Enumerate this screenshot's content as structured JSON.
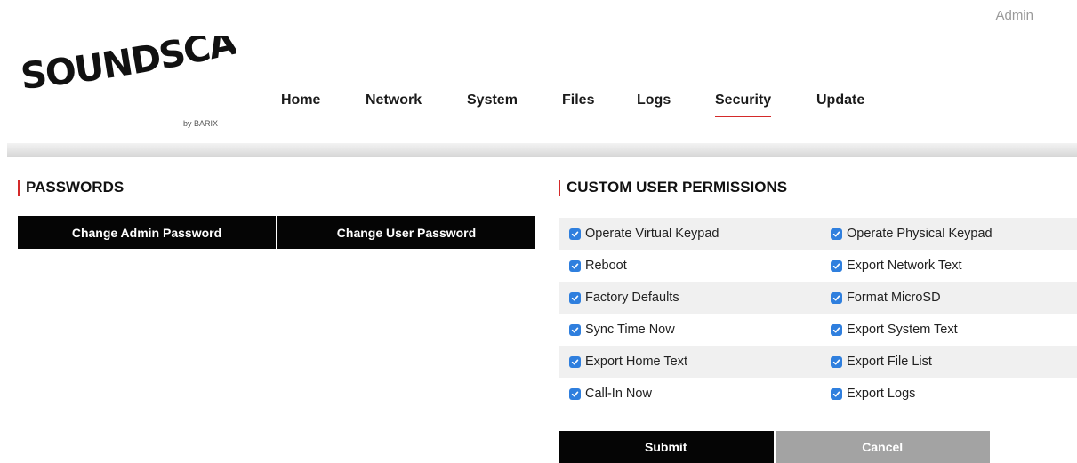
{
  "header": {
    "user_label": "Admin",
    "logo_text": "SOUNDSCAPE",
    "logo_sub": "by BARIX"
  },
  "nav": {
    "items": [
      {
        "label": "Home",
        "active": false
      },
      {
        "label": "Network",
        "active": false
      },
      {
        "label": "System",
        "active": false
      },
      {
        "label": "Files",
        "active": false
      },
      {
        "label": "Logs",
        "active": false
      },
      {
        "label": "Security",
        "active": true
      },
      {
        "label": "Update",
        "active": false
      }
    ],
    "active_color": "#d42a2a"
  },
  "passwords": {
    "title": "PASSWORDS",
    "change_admin_label": "Change Admin Password",
    "change_user_label": "Change User Password"
  },
  "permissions": {
    "title": "CUSTOM USER PERMISSIONS",
    "rows": [
      [
        {
          "label": "Operate Virtual Keypad",
          "checked": true
        },
        {
          "label": "Operate Physical Keypad",
          "checked": true
        }
      ],
      [
        {
          "label": "Reboot",
          "checked": true
        },
        {
          "label": "Export Network Text",
          "checked": true
        }
      ],
      [
        {
          "label": "Factory Defaults",
          "checked": true
        },
        {
          "label": "Format MicroSD",
          "checked": true
        }
      ],
      [
        {
          "label": "Sync Time Now",
          "checked": true
        },
        {
          "label": "Export System Text",
          "checked": true
        }
      ],
      [
        {
          "label": "Export Home Text",
          "checked": true
        },
        {
          "label": "Export File List",
          "checked": true
        }
      ],
      [
        {
          "label": "Call-In Now",
          "checked": true
        },
        {
          "label": "Export Logs",
          "checked": true
        }
      ]
    ],
    "submit_label": "Submit",
    "cancel_label": "Cancel",
    "checkbox_color": "#2f7fde"
  }
}
